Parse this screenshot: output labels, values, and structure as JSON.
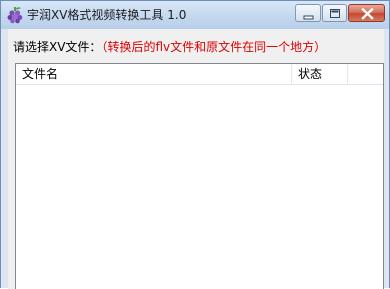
{
  "window": {
    "title": "宇润XV格式视频转换工具 1.0"
  },
  "prompt": {
    "label": "请选择XV文件：",
    "hint": "（转换后的flv文件和原文件在同一个地方）"
  },
  "file_list": {
    "columns": [
      "文件名",
      "状态"
    ],
    "rows": []
  },
  "icons": {
    "app": "grape-cluster-icon",
    "minimize": "minimize-icon",
    "maximize": "maximize-icon",
    "close": "close-icon"
  },
  "colors": {
    "hint_text": "#e00000"
  }
}
